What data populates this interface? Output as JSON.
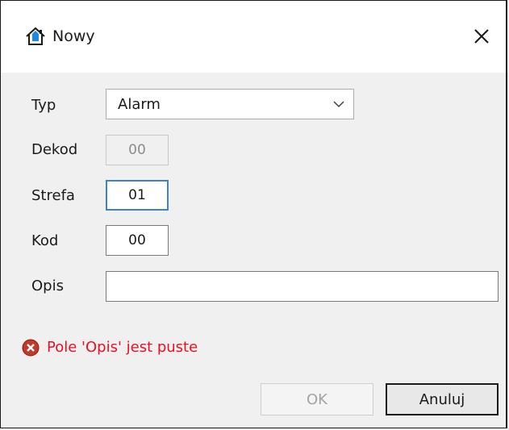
{
  "window": {
    "title": "Nowy",
    "icon": "home-icon"
  },
  "form": {
    "typ": {
      "label": "Typ",
      "value": "Alarm"
    },
    "dekod": {
      "label": "Dekod",
      "value": "00"
    },
    "strefa": {
      "label": "Strefa",
      "value": "01"
    },
    "kod": {
      "label": "Kod",
      "value": "00"
    },
    "opis": {
      "label": "Opis",
      "value": ""
    }
  },
  "error": {
    "message": "Pole 'Opis' jest puste",
    "color": "#e81123"
  },
  "buttons": {
    "ok": "OK",
    "cancel": "Anuluj"
  },
  "colors": {
    "accent": "#3c82cc",
    "home_icon": "#1e88e5",
    "error_icon": "#c0392b"
  }
}
